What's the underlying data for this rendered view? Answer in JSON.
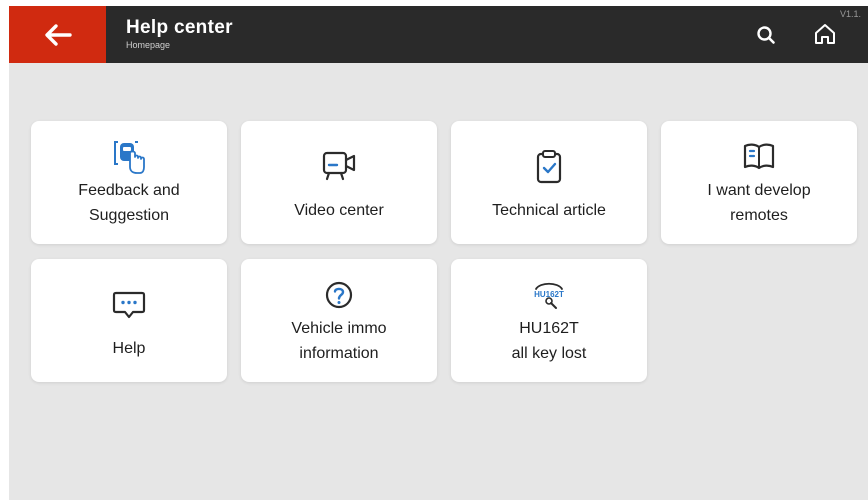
{
  "header": {
    "title": "Help center",
    "subtitle": "Homepage",
    "version": "V1.1."
  },
  "icons": {
    "back": "back-arrow-icon",
    "search": "search-icon",
    "home": "home-icon"
  },
  "colors": {
    "accent": "#d02a10",
    "topbar": "#2a2a2a",
    "icon_blue": "#2a77c8",
    "background": "#e6e6e6"
  },
  "tiles": [
    {
      "label": "Feedback and\nSuggestion",
      "icon": "feedback-touch-icon"
    },
    {
      "label": "Video center",
      "icon": "video-camera-icon"
    },
    {
      "label": "Technical article",
      "icon": "clipboard-check-icon"
    },
    {
      "label": "I want develop\nremotes",
      "icon": "open-book-icon"
    },
    {
      "label": "Help",
      "icon": "chat-bubble-icon"
    },
    {
      "label": "Vehicle immo\ninformation",
      "icon": "question-circle-icon"
    },
    {
      "label": "HU162T\nall key lost",
      "icon": "hu162t-key-icon",
      "icon_text": "HU162T"
    }
  ]
}
